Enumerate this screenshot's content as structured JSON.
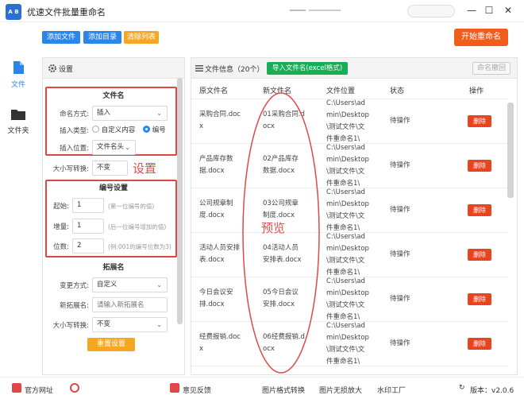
{
  "app": {
    "logo_text": "A B",
    "title": "优速文件批量重命名"
  },
  "window_controls": {
    "minimize": "—",
    "restore": "☐",
    "close": "✕"
  },
  "nav": {
    "items": [
      {
        "label": "文件",
        "icon": "file-icon"
      },
      {
        "label": "文件夹",
        "icon": "folder-icon"
      }
    ]
  },
  "toolbar": {
    "add_file": "添加文件",
    "add_dir": "添加目录",
    "clear_list": "清除列表",
    "start": "开始重命名"
  },
  "settings": {
    "header": "设置",
    "filename": {
      "title": "文件名",
      "method_label": "命名方式:",
      "method_value": "插入",
      "insert_type_label": "插入类型:",
      "insert_type_options": [
        "自定义内容",
        "编号"
      ],
      "insert_type_selected": "编号",
      "insert_pos_label": "插入位置:",
      "insert_pos_value": "文件名头"
    },
    "case_label": "大小写转换:",
    "case_value": "不变",
    "numbering": {
      "title": "编号设置",
      "start_label": "起始:",
      "start_value": "1",
      "start_hint": "(第一位编号的值)",
      "step_label": "增量:",
      "step_value": "1",
      "step_hint": "(后一位编号增加的值)",
      "digits_label": "位数:",
      "digits_value": "2",
      "digits_hint": "(例:001的编号位数为3)"
    },
    "extension": {
      "title": "拓展名",
      "method_label": "变更方式:",
      "method_value": "自定义",
      "new_ext_label": "新拓展名:",
      "new_ext_placeholder": "请输入新拓展名",
      "case_label": "大小写转换:",
      "case_value": "不变"
    },
    "reset": "重置设置",
    "annotation": "设置"
  },
  "files": {
    "header": "文件信息（20个）",
    "import_button": "导入文件名(excel格式)",
    "undo_button": "命名撤回",
    "columns": [
      "原文件名",
      "新文件名",
      "文件位置",
      "状态",
      "操作"
    ],
    "rows": [
      {
        "orig": [
          "采购合同.doc",
          "x"
        ],
        "new": [
          "01采购合同.d",
          "ocx"
        ],
        "loc": [
          "C:\\Users\\ad",
          "min\\Desktop",
          "\\测试文件\\文",
          "件重命名1\\"
        ],
        "status": "待操作",
        "action": "删除"
      },
      {
        "orig": [
          "产品库存数",
          "据.docx"
        ],
        "new": [
          "02产品库存",
          "数据.docx"
        ],
        "loc": [
          "C:\\Users\\ad",
          "min\\Desktop",
          "\\测试文件\\文",
          "件重命名1\\"
        ],
        "status": "待操作",
        "action": "删除"
      },
      {
        "orig": [
          "公司规章制",
          "度.docx"
        ],
        "new": [
          "03公司规章",
          "制度.docx"
        ],
        "loc": [
          "C:\\Users\\ad",
          "min\\Desktop",
          "\\测试文件\\文",
          "件重命名1\\"
        ],
        "status": "待操作",
        "action": "删除"
      },
      {
        "orig": [
          "活动人员安排",
          "表.docx"
        ],
        "new": [
          "04活动人员",
          "安排表.docx"
        ],
        "loc": [
          "C:\\Users\\ad",
          "min\\Desktop",
          "\\测试文件\\文",
          "件重命名1\\"
        ],
        "status": "待操作",
        "action": "删除"
      },
      {
        "orig": [
          "今日会议安",
          "排.docx"
        ],
        "new": [
          "05今日会议",
          "安排.docx"
        ],
        "loc": [
          "C:\\Users\\ad",
          "min\\Desktop",
          "\\测试文件\\文",
          "件重命名1\\"
        ],
        "status": "待操作",
        "action": "删除"
      },
      {
        "orig": [
          "经费报销.doc",
          "x"
        ],
        "new": [
          "06经费报销.d",
          "ocx"
        ],
        "loc": [
          "C:\\Users\\ad",
          "min\\Desktop",
          "\\测试文件\\文",
          "件重命名1\\"
        ],
        "status": "待操作",
        "action": "删除"
      }
    ],
    "annotation": "预览"
  },
  "statusbar": {
    "website": "官方网址",
    "feedback": "意见反馈",
    "img_convert": "图片格式转换",
    "img_enlarge": "图片无损放大",
    "watermark": "水印工厂",
    "version": "版本：v2.0.6"
  },
  "colors": {
    "blue": "#2a86e8",
    "orange": "#f25c1a",
    "green": "#1aad56",
    "red": "#e04848"
  }
}
